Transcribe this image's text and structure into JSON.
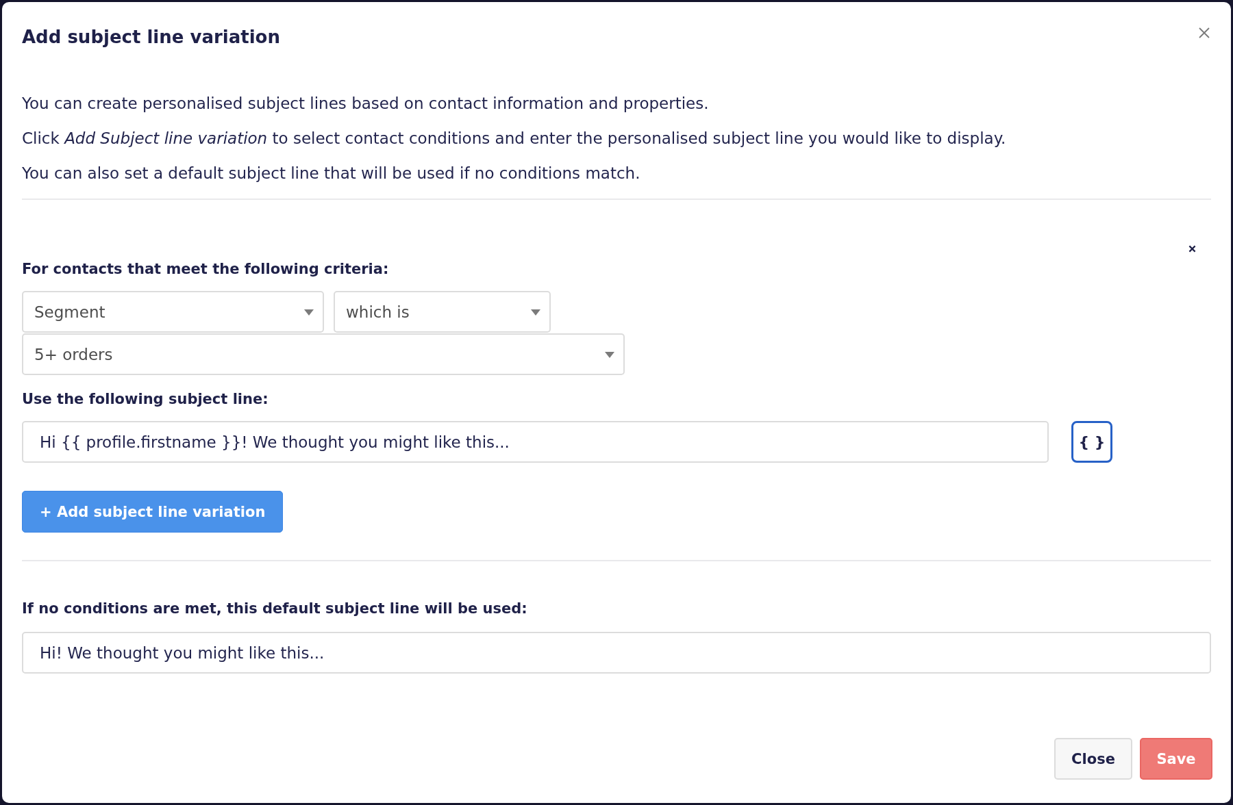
{
  "dialog": {
    "title": "Add subject line variation",
    "intro": [
      "You can create personalised subject lines based on contact information and properties.",
      "Click *Add Subject line variation* to select contact conditions and enter the personalised subject line you would like to display.",
      "You can also set a default subject line that will be used if no conditions match."
    ],
    "variation": {
      "criteria_label": "For contacts that meet the following criteria:",
      "selects": [
        "Segment",
        "which is",
        "5+ orders"
      ],
      "subject_label": "Use the following subject line:",
      "subject_value": "Hi {{ profile.firstname }}! We thought you might like this...",
      "variable_button": "{ }"
    },
    "add_button": "+ Add subject line variation",
    "default_subject": {
      "label": "If no conditions are met, this default subject line will be used:",
      "value": "Hi! We thought you might like this..."
    },
    "buttons": [
      {
        "label": "Close",
        "kind": "secondary"
      },
      {
        "label": "Save",
        "kind": "primary"
      }
    ]
  }
}
